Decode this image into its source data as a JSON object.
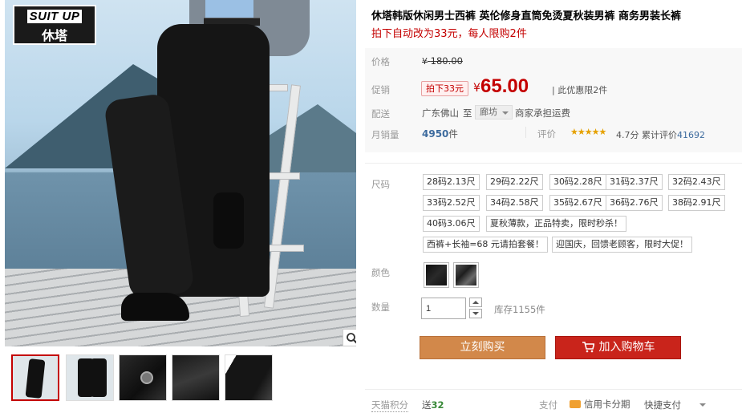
{
  "brand": {
    "logo_en": "SUIT UP",
    "logo_cn": "休塔"
  },
  "product": {
    "title": "休塔韩版休闲男士西裤 英伦修身直筒免烫夏秋装男裤 商务男装长裤",
    "promo": "拍下自动改为33元，每人限购2件"
  },
  "price_block": {
    "list_label": "价格",
    "list_currency": "¥",
    "list_price": "180.00",
    "promo_label": "促销",
    "promo_tag": "拍下33元",
    "currency": "¥",
    "promo_price": "65.00",
    "limit_note": "| 此优惠限2件"
  },
  "shipping": {
    "label": "配送",
    "from": "广东佛山",
    "to_word": "至",
    "destination": "廊坊",
    "fee": "商家承担运费"
  },
  "stats": {
    "sales_label": "月销量",
    "sales_count": "4950",
    "sales_unit": "件",
    "review_label": "评价",
    "stars": "★★★★★",
    "rating": "4.7分",
    "reviews_prefix": "累计评价",
    "reviews_count": "41692",
    "rating_value": 4.7
  },
  "options": {
    "size_label": "尺码",
    "sizes": [
      "28码2.13尺",
      "29码2.22尺",
      "30码2.28尺",
      "31码2.37尺",
      "32码2.43尺",
      "33码2.52尺",
      "34码2.58尺",
      "35码2.67尺",
      "36码2.76尺",
      "38码2.91尺",
      "40码3.06尺",
      "夏秋薄款，正品特卖，限时秒杀！",
      "西裤+长袖=68 元请拍套餐！",
      "迎国庆，回馈老顾客，限时大促！"
    ],
    "color_label": "颜色",
    "colors": [
      "#1a1a1a",
      "#3a3a3a"
    ],
    "qty_label": "数量",
    "qty_value": "1",
    "stock": "库存1155件"
  },
  "actions": {
    "buy_now": "立刻购买",
    "add_cart": "加入购物车"
  },
  "footer": {
    "points_label": "天猫积分",
    "points_prefix": "送",
    "points_value": "32",
    "pay_label": "支付",
    "pay_credit": "信用卡分期",
    "pay_quick": "快捷支付"
  },
  "icons": {
    "zoom": "magnifier-icon",
    "cart": "cart-icon",
    "card": "credit-card-icon"
  }
}
